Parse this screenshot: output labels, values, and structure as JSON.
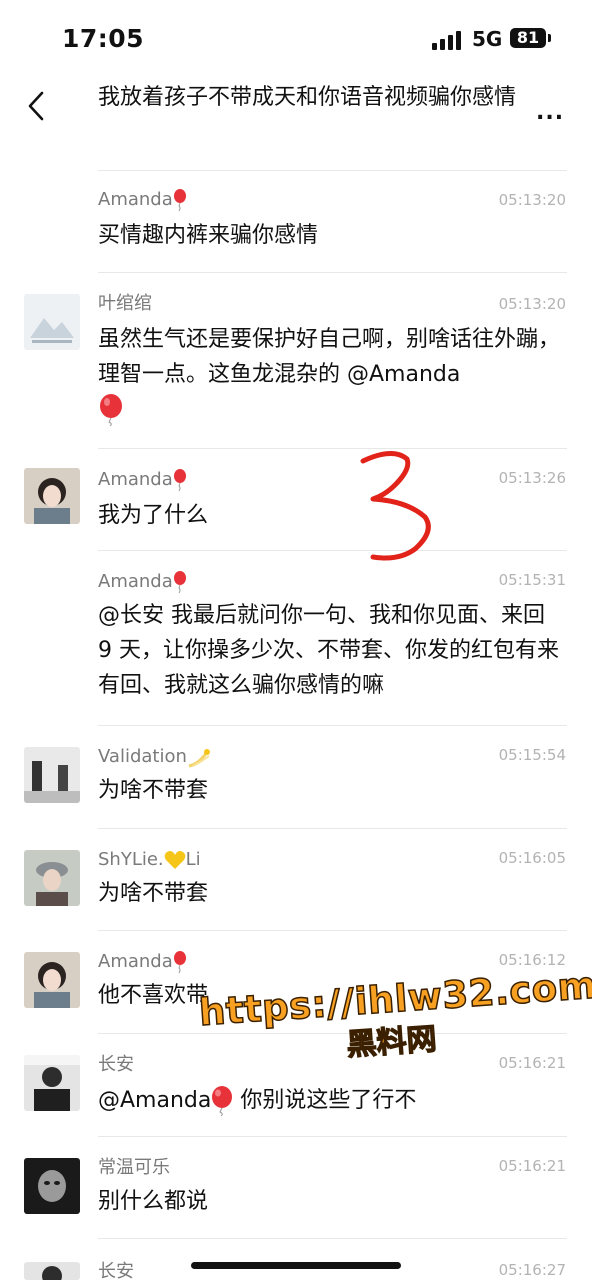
{
  "status_bar": {
    "time": "17:05",
    "network": "5G",
    "battery": "81"
  },
  "first_message": {
    "text": "我放着孩子不带成天和你语音视频骗你感情"
  },
  "more_label": "...",
  "messages": [
    {
      "sender": "Amanda",
      "time": "05:13:20",
      "text": "买情趣内裤来骗你感情"
    },
    {
      "sender": "叶绾绾",
      "time": "05:13:20",
      "text": "虽然生气还是要保护好自己啊，别啥话往外蹦，理智一点。这鱼龙混杂的 @Amanda"
    },
    {
      "sender": "Amanda",
      "time": "05:13:26",
      "text": "我为了什么"
    },
    {
      "sender": "Amanda",
      "time": "05:15:31",
      "text": "@长安 我最后就问你一句、我和你见面、来回 9 天，让你操多少次、不带套、你发的红包有来有回、我就这么骗你感情的嘛"
    },
    {
      "sender": "Validation",
      "time": "05:15:54",
      "text": "为啥不带套"
    },
    {
      "sender_prefix": "ShYLie.",
      "sender_suffix": "Li",
      "time": "05:16:05",
      "text": "为啥不带套"
    },
    {
      "sender": "Amanda",
      "time": "05:16:12",
      "text": "他不喜欢带"
    },
    {
      "sender": "长安",
      "time": "05:16:21",
      "text_prefix": "@Amanda",
      "text_suffix": " 你别说这些了行不"
    },
    {
      "sender": "常温可乐",
      "time": "05:16:21",
      "text": "别什么都说"
    },
    {
      "sender": "长安",
      "time": "05:16:27",
      "text": ""
    }
  ],
  "watermark": {
    "url": "https://ihlw32.com",
    "site": "黑料网"
  },
  "colors": {
    "balloon": "#e8323a",
    "heart": "#f5c518",
    "mark": "#e2231a",
    "watermark": "#f7a021"
  },
  "icons": [
    "back-chevron-icon",
    "more-dots-icon",
    "balloon-icon",
    "shooting-star-icon",
    "yellow-heart-icon"
  ]
}
